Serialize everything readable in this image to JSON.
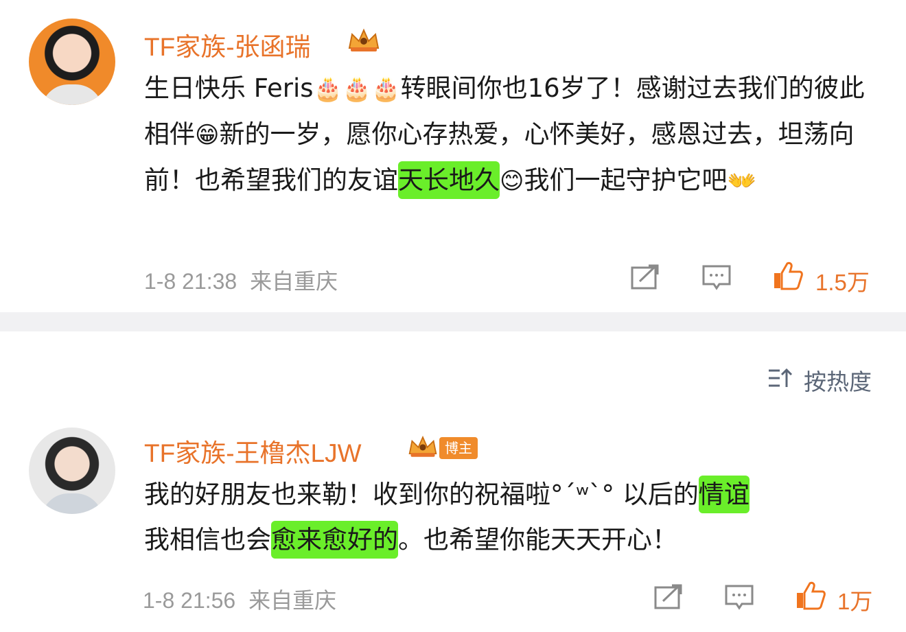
{
  "comments": [
    {
      "author": "TF家族-张函瑞",
      "content": {
        "pre": "生日快乐 Feris",
        "cake_emoji": "🎂🎂🎂",
        "mid1": "转眼间你也16岁了！感谢过去我们的彼此相伴",
        "grin_emoji": "😁",
        "mid2": "新的一岁，愿你心存热爱，心怀美好，感恩过去，坦荡向前！也希望我们的友谊",
        "highlight": "天长地久",
        "smile_emoji": "😊",
        "post": "我们一起守护它吧",
        "hands_emoji": "👐"
      },
      "timestamp": "1-8 21:38",
      "location": "来自重庆",
      "likes": "1.5万",
      "icons": [
        "share-icon",
        "comment-icon",
        "like-icon"
      ]
    },
    {
      "author": "TF家族-王橹杰LJW",
      "badge_label": "博主",
      "content": {
        "pre": "我的好朋友也来勒！收到你的祝福啦",
        "kaomoji": "°´ʷ`°",
        "mid1": " 以后的",
        "highlight1": "情谊",
        "mid2": "我相信也会",
        "highlight2": "愈来愈好的",
        "post": "。也希望你能天天开心！"
      },
      "timestamp": "1-8 21:56",
      "location": "来自重庆",
      "likes": "1万",
      "icons": [
        "share-icon",
        "comment-icon",
        "like-icon"
      ]
    }
  ],
  "sort": {
    "label": "按热度",
    "icon": "sort-icon"
  },
  "colors": {
    "accent": "#e8732a",
    "highlight": "#6aee2a",
    "meta": "#9a9a9a",
    "divider": "#f1f1f3"
  }
}
